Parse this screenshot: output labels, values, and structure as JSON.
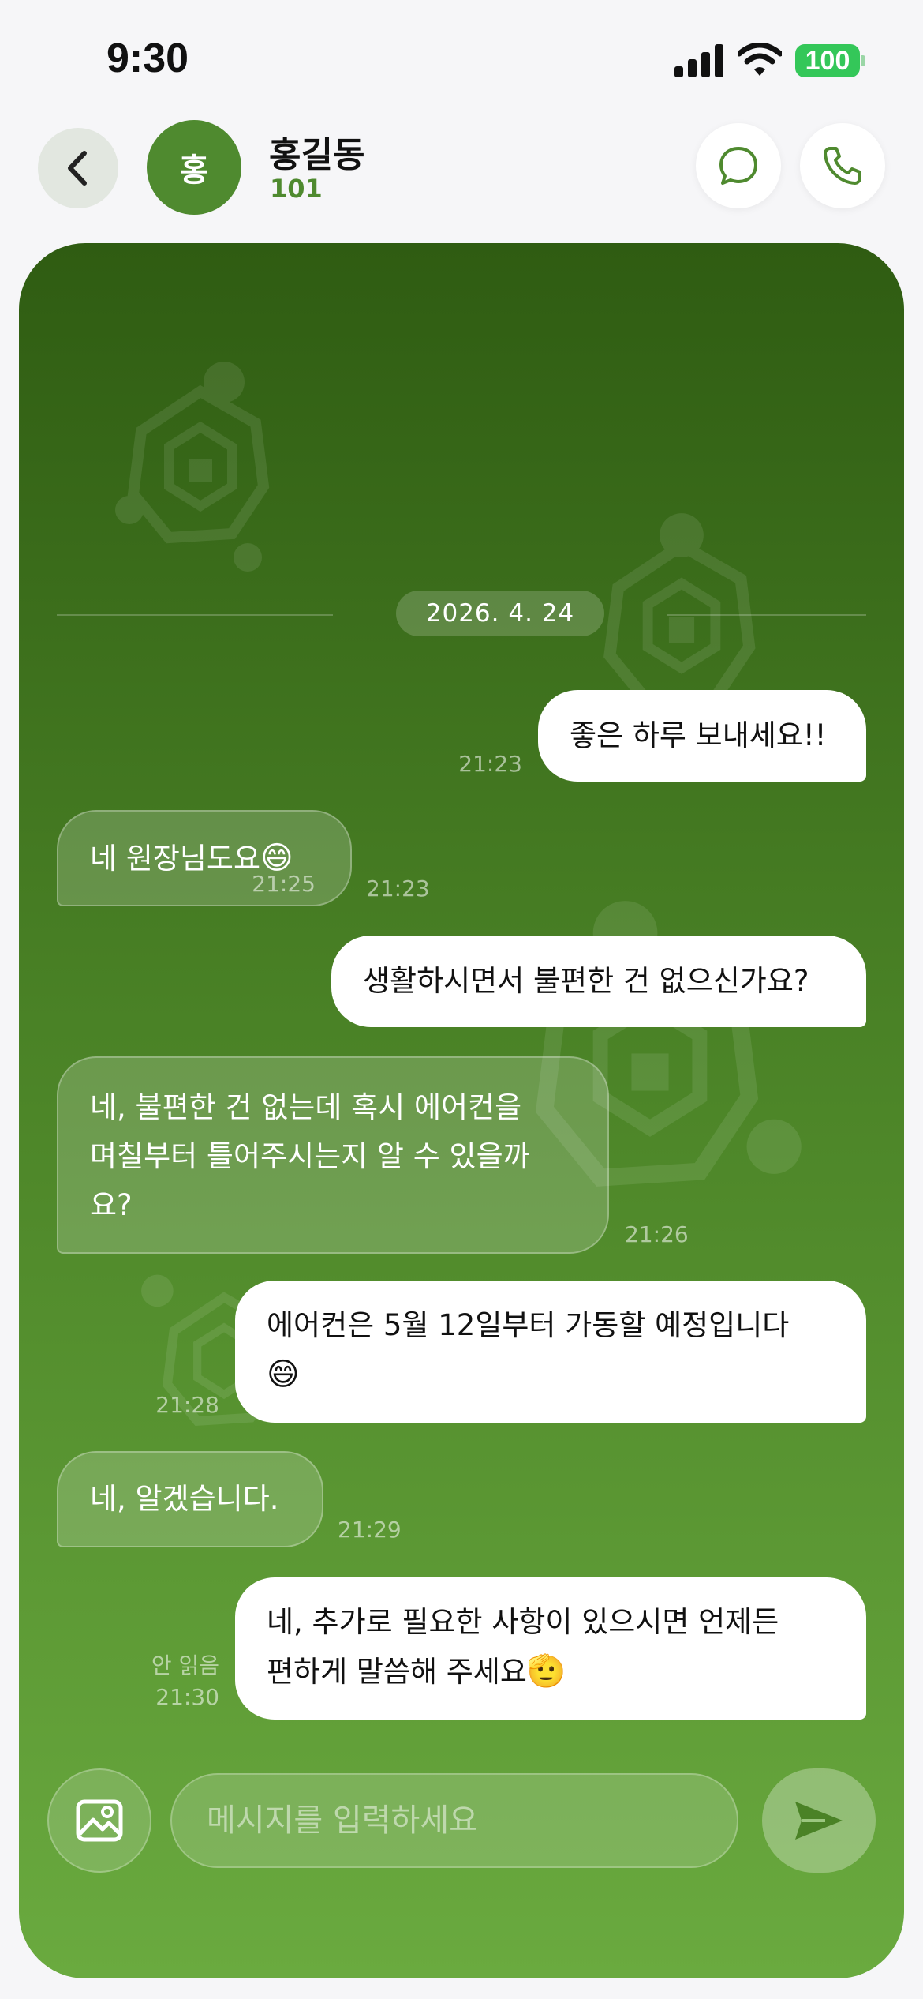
{
  "status_bar": {
    "time": "9:30",
    "battery": "100"
  },
  "header": {
    "avatar_initial": "홍",
    "contact_name": "홍길동",
    "contact_unit": "101",
    "icons": {
      "back": "chevron-left-icon",
      "chat": "chat-bubble-icon",
      "call": "phone-icon"
    }
  },
  "chat": {
    "date": "2026. 4. 24",
    "messages": [
      {
        "direction": "out",
        "text": "좋은 하루 보내세요!!",
        "time": "21:23"
      },
      {
        "direction": "in",
        "text": "네 원장님도요",
        "emoji": "😄",
        "time": "21:23"
      },
      {
        "direction": "out",
        "text": "생활하시면서 불편한 건 없으신가요?",
        "time": "21:25"
      },
      {
        "direction": "in",
        "lines": [
          "네, 불편한 건 없는데 혹시 에어컨을",
          "며칠부터 틀어주시는지 알 수 있을까",
          "요?"
        ],
        "time": "21:26"
      },
      {
        "direction": "out",
        "lines": [
          "에어컨은 5월 12일부터 가동할 예정입니다"
        ],
        "emoji": "😄",
        "time": "21:28"
      },
      {
        "direction": "in",
        "text": "네, 알겠습니다.",
        "time": "21:29"
      },
      {
        "direction": "out",
        "lines": [
          "네, 추가로 필요한 사항이 있으시면 언제든",
          "편하게 말씀해 주세요"
        ],
        "emoji": "🫡",
        "status": "안 읽음",
        "time": "21:30"
      }
    ]
  },
  "input": {
    "placeholder": "메시지를 입력하세요",
    "attach_icon": "image-icon",
    "send_icon": "send-icon"
  },
  "colors": {
    "brand_green": "#4f8a2f",
    "battery_green": "#34c759"
  }
}
